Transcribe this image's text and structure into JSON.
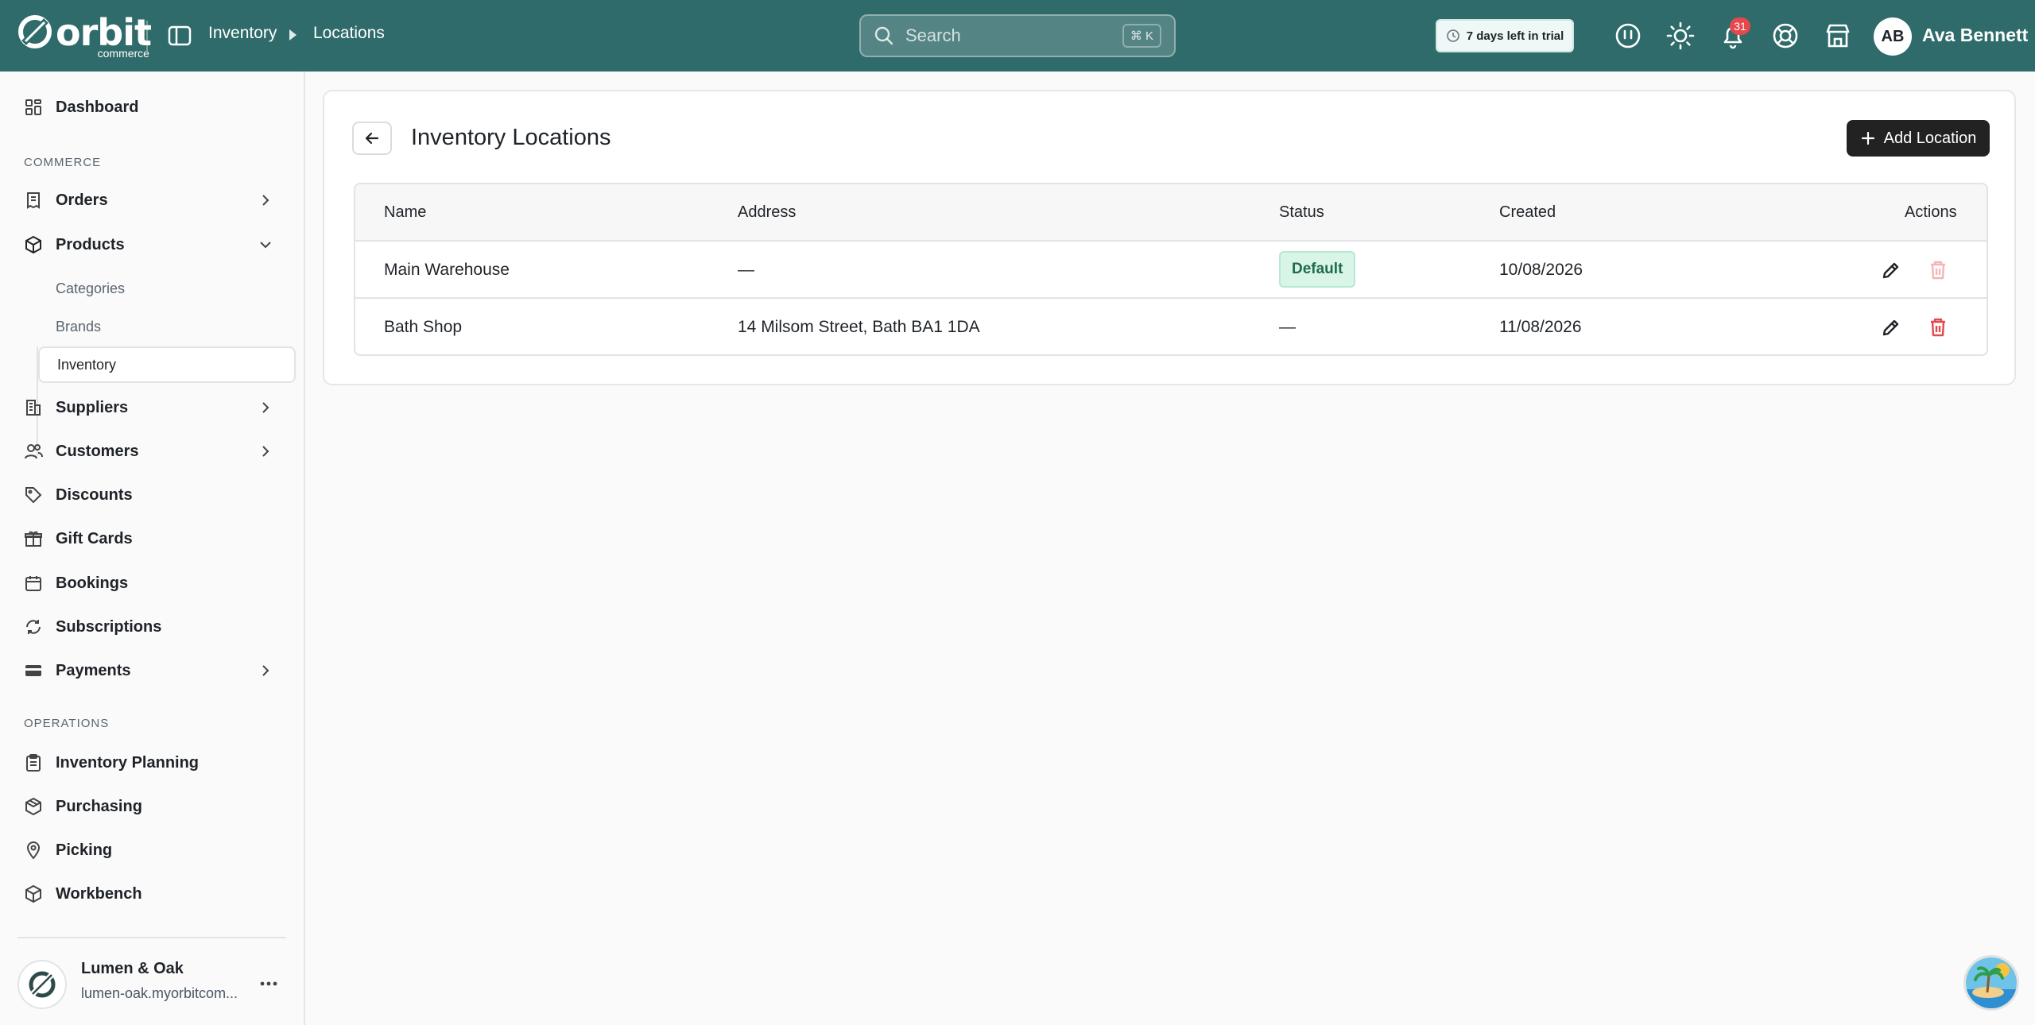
{
  "brand": {
    "name": "orbit",
    "sub": "commerce"
  },
  "breadcrumb": [
    "Inventory",
    "Locations"
  ],
  "search": {
    "placeholder": "Search",
    "shortcut": "⌘ K"
  },
  "trial": {
    "label": "7 days left in trial"
  },
  "notifications": {
    "count": "31"
  },
  "user": {
    "initials": "AB",
    "name": "Ava Bennett"
  },
  "sidebar": {
    "dashboard": "Dashboard",
    "section_commerce": "COMMERCE",
    "orders": "Orders",
    "products": "Products",
    "product_sub": [
      "Categories",
      "Brands",
      "Inventory"
    ],
    "suppliers": "Suppliers",
    "customers": "Customers",
    "discounts": "Discounts",
    "gift_cards": "Gift Cards",
    "bookings": "Bookings",
    "subscriptions": "Subscriptions",
    "payments": "Payments",
    "section_operations": "OPERATIONS",
    "inventory_planning": "Inventory Planning",
    "purchasing": "Purchasing",
    "picking": "Picking",
    "workbench": "Workbench"
  },
  "store": {
    "name": "Lumen & Oak",
    "url": "lumen-oak.myorbitcom..."
  },
  "page": {
    "title": "Inventory Locations",
    "add_button": "Add Location"
  },
  "table": {
    "headers": {
      "name": "Name",
      "address": "Address",
      "status": "Status",
      "created": "Created",
      "actions": "Actions"
    },
    "rows": [
      {
        "name": "Main Warehouse",
        "address": "—",
        "status": "Default",
        "created": "10/08/2026"
      },
      {
        "name": "Bath Shop",
        "address": "14 Milsom Street, Bath BA1 1DA",
        "status": "—",
        "created": "11/08/2026"
      }
    ]
  },
  "colors": {
    "topbar": "#2f6b6a",
    "danger": "#e5484d",
    "badge_bg": "#d9f5e8"
  }
}
